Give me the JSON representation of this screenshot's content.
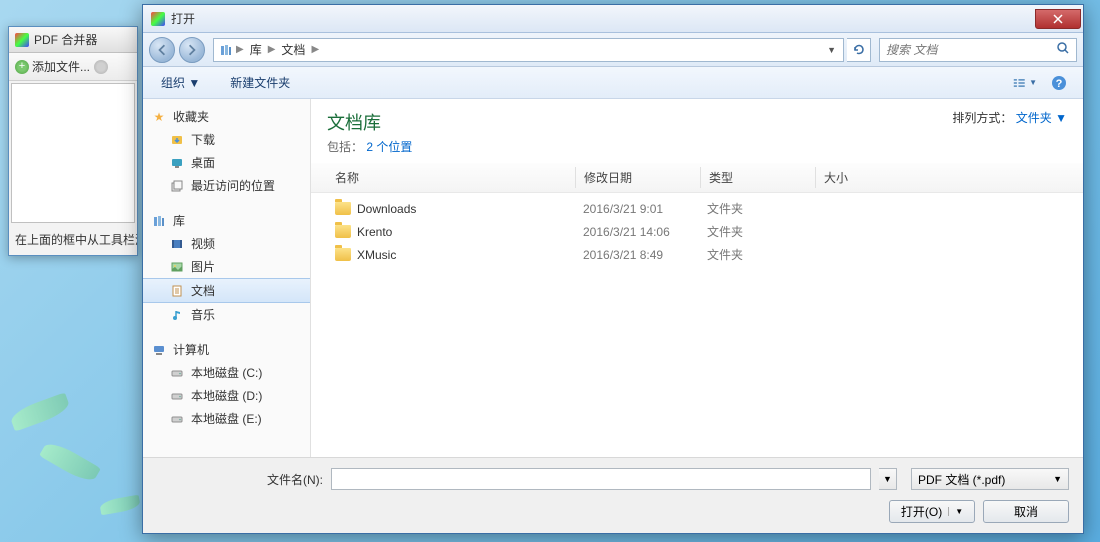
{
  "bgwin": {
    "title": "PDF 合并器",
    "add_btn": "添加文件...",
    "hint": "在上面的框中从工具栏添"
  },
  "dialog": {
    "title": "打开",
    "breadcrumb": [
      "库",
      "文档"
    ],
    "search_placeholder": "搜索 文档",
    "toolbar": {
      "organize": "组织 ▼",
      "newfolder": "新建文件夹"
    },
    "lib": {
      "title": "文档库",
      "sub_prefix": "包括：",
      "sub_link": "2 个位置"
    },
    "sort": {
      "label": "排列方式：",
      "value": "文件夹 ▼"
    },
    "cols": {
      "name": "名称",
      "date": "修改日期",
      "type": "类型",
      "size": "大小"
    },
    "files": [
      {
        "name": "Downloads",
        "date": "2016/3/21 9:01",
        "type": "文件夹"
      },
      {
        "name": "Krento",
        "date": "2016/3/21 14:06",
        "type": "文件夹"
      },
      {
        "name": "XMusic",
        "date": "2016/3/21 8:49",
        "type": "文件夹"
      }
    ],
    "sidebar": {
      "fav_head": "收藏夹",
      "fav": [
        "下载",
        "桌面",
        "最近访问的位置"
      ],
      "lib_head": "库",
      "lib": [
        "视频",
        "图片",
        "文档",
        "音乐"
      ],
      "comp_head": "计算机",
      "comp": [
        "本地磁盘 (C:)",
        "本地磁盘 (D:)",
        "本地磁盘 (E:)"
      ]
    },
    "footer": {
      "fn_label": "文件名(N):",
      "filter": "PDF 文档 (*.pdf)",
      "open": "打开(O)",
      "cancel": "取消"
    }
  }
}
